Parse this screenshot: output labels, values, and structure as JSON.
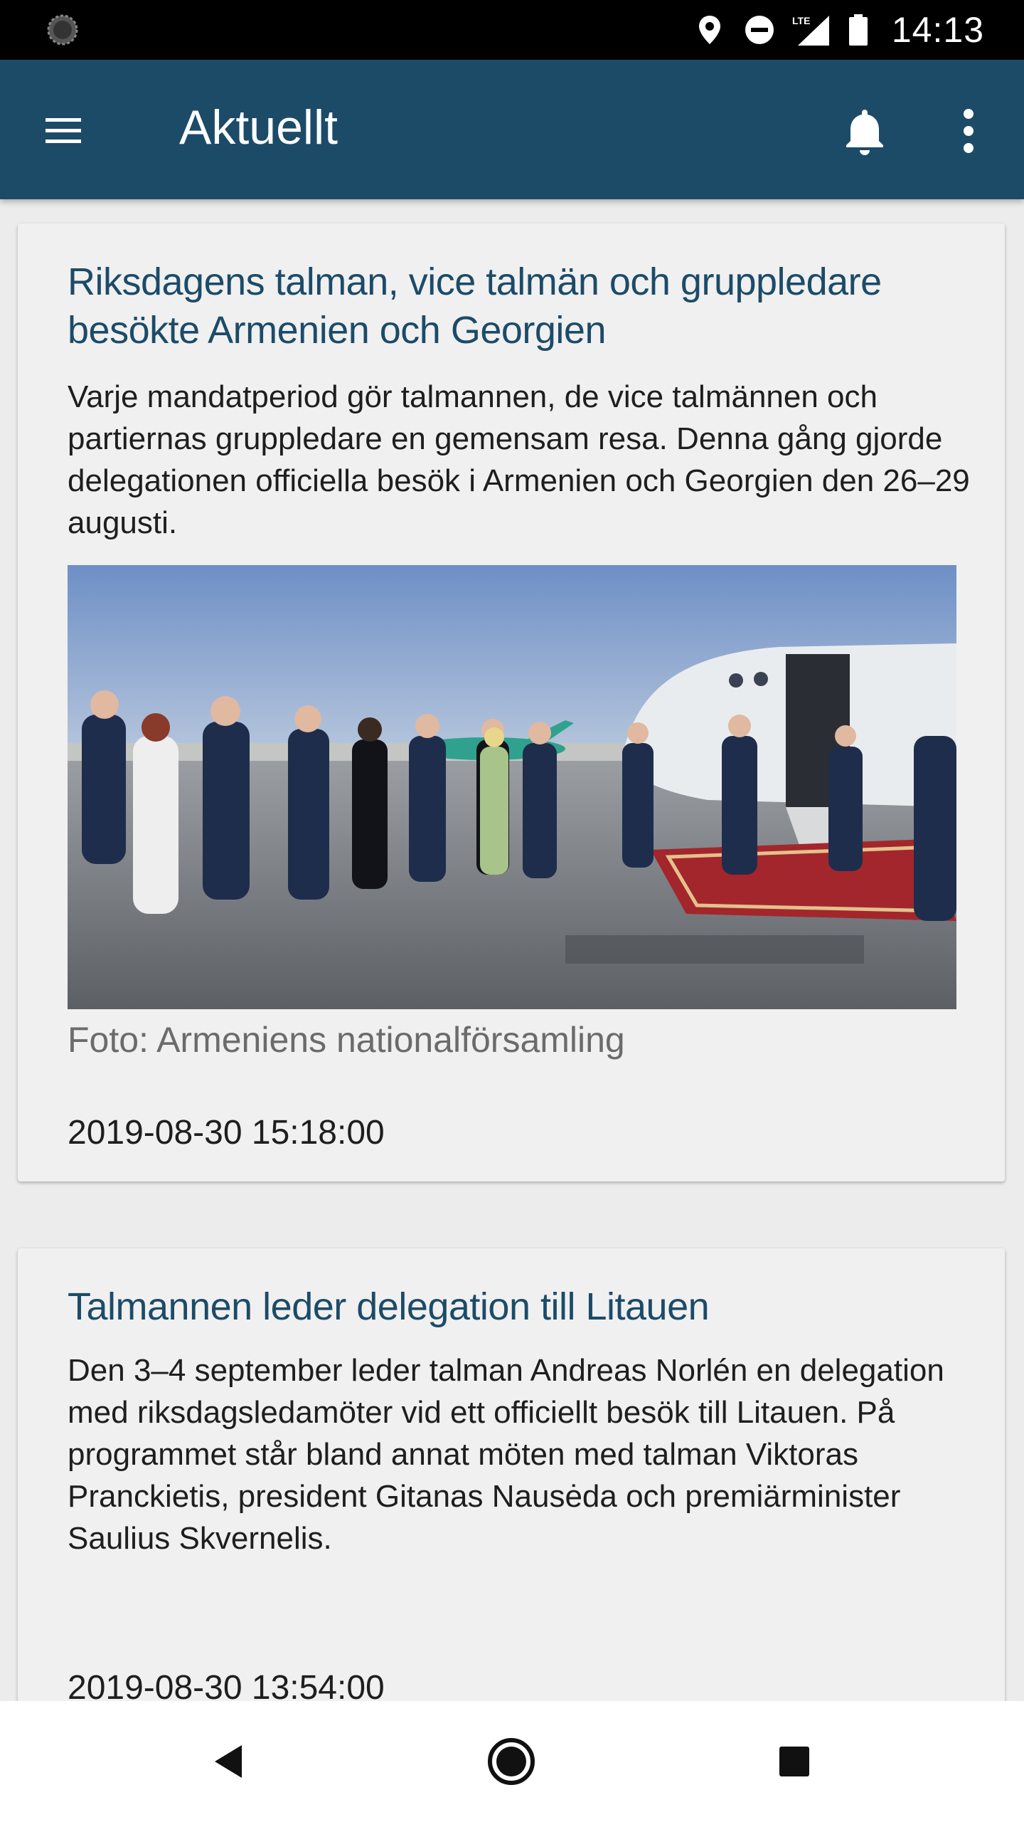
{
  "status_bar": {
    "time": "14:13",
    "network": "LTE",
    "icons": [
      "notification-dot-icon",
      "location-icon",
      "do-not-disturb-icon",
      "signal-icon",
      "battery-icon"
    ]
  },
  "app_bar": {
    "title": "Aktuellt",
    "icons": [
      "menu-icon",
      "bell-icon",
      "more-vert-icon"
    ],
    "background_color": "#1c4b68"
  },
  "articles": [
    {
      "headline": "Riksdagens talman, vice talmän och gruppledare besökte Armenien och Georgien",
      "summary": "Varje mandatperiod gör talmannen, de vice talmännen och partiernas gruppledare en gemensam resa. Denna gång gjorde delegationen officiella besök i Armenien och Georgien den 26–29 augusti.",
      "photo_caption": "Foto: Armeniens nationalförsamling",
      "date": "2019-08-30 15:18:00"
    },
    {
      "headline": "Talmannen leder delegation till Litauen",
      "summary": "Den 3–4 september leder talman Andreas Norlén en delegation med riksdagsledamöter vid ett officiellt besök till Litauen. På programmet står bland annat möten med talman Viktoras Pranckietis, president Gitanas Nausėda och premiärminister Saulius Skvernelis.",
      "date": "2019-08-30 13:54:00"
    }
  ],
  "nav_bar": {
    "icons": [
      "back-icon",
      "home-icon",
      "recents-icon"
    ]
  },
  "colors": {
    "accent": "#1c4b68",
    "card_background": "#f0f0f0",
    "page_background": "#ececec"
  }
}
